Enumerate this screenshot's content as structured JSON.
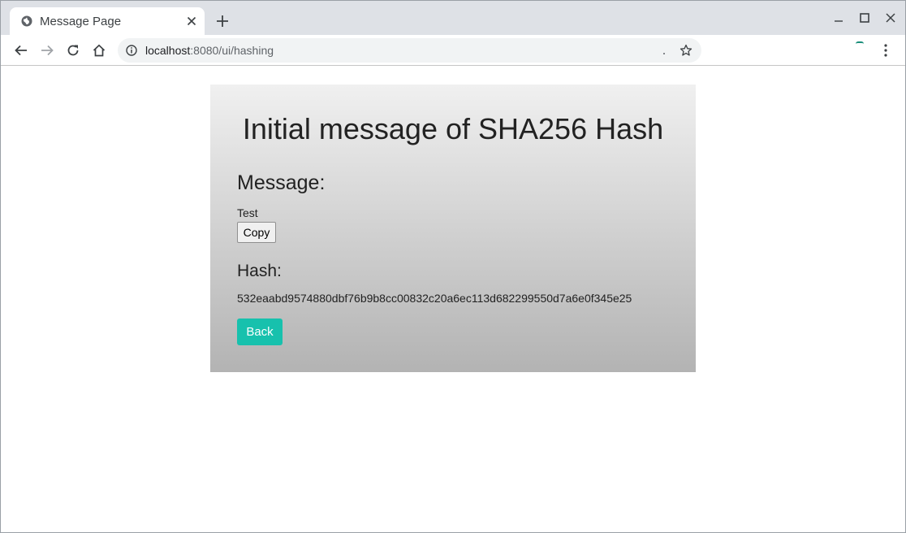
{
  "browser": {
    "tab_title": "Message Page",
    "url_host": "localhost",
    "url_rest": ":8080/ui/hashing"
  },
  "page": {
    "title": "Initial message of SHA256 Hash",
    "message_heading": "Message:",
    "message_value": "Test",
    "copy_label": "Copy",
    "hash_heading": "Hash:",
    "hash_value": "532eaabd9574880dbf76b9b8cc00832c20a6ec113d682299550d7a6e0f345e25",
    "back_label": "Back"
  },
  "colors": {
    "accent": "#17c1ad",
    "card_top": "#f0f0f0",
    "card_bottom": "#b3b3b3"
  },
  "icons": {
    "favicon": "globe-icon",
    "tab_close": "close-icon",
    "new_tab": "plus-icon",
    "back": "arrow-left-icon",
    "forward": "arrow-right-icon",
    "reload": "reload-icon",
    "home": "home-icon",
    "info": "info-icon",
    "bookmark": "star-icon",
    "menu": "kebab-menu-icon"
  }
}
